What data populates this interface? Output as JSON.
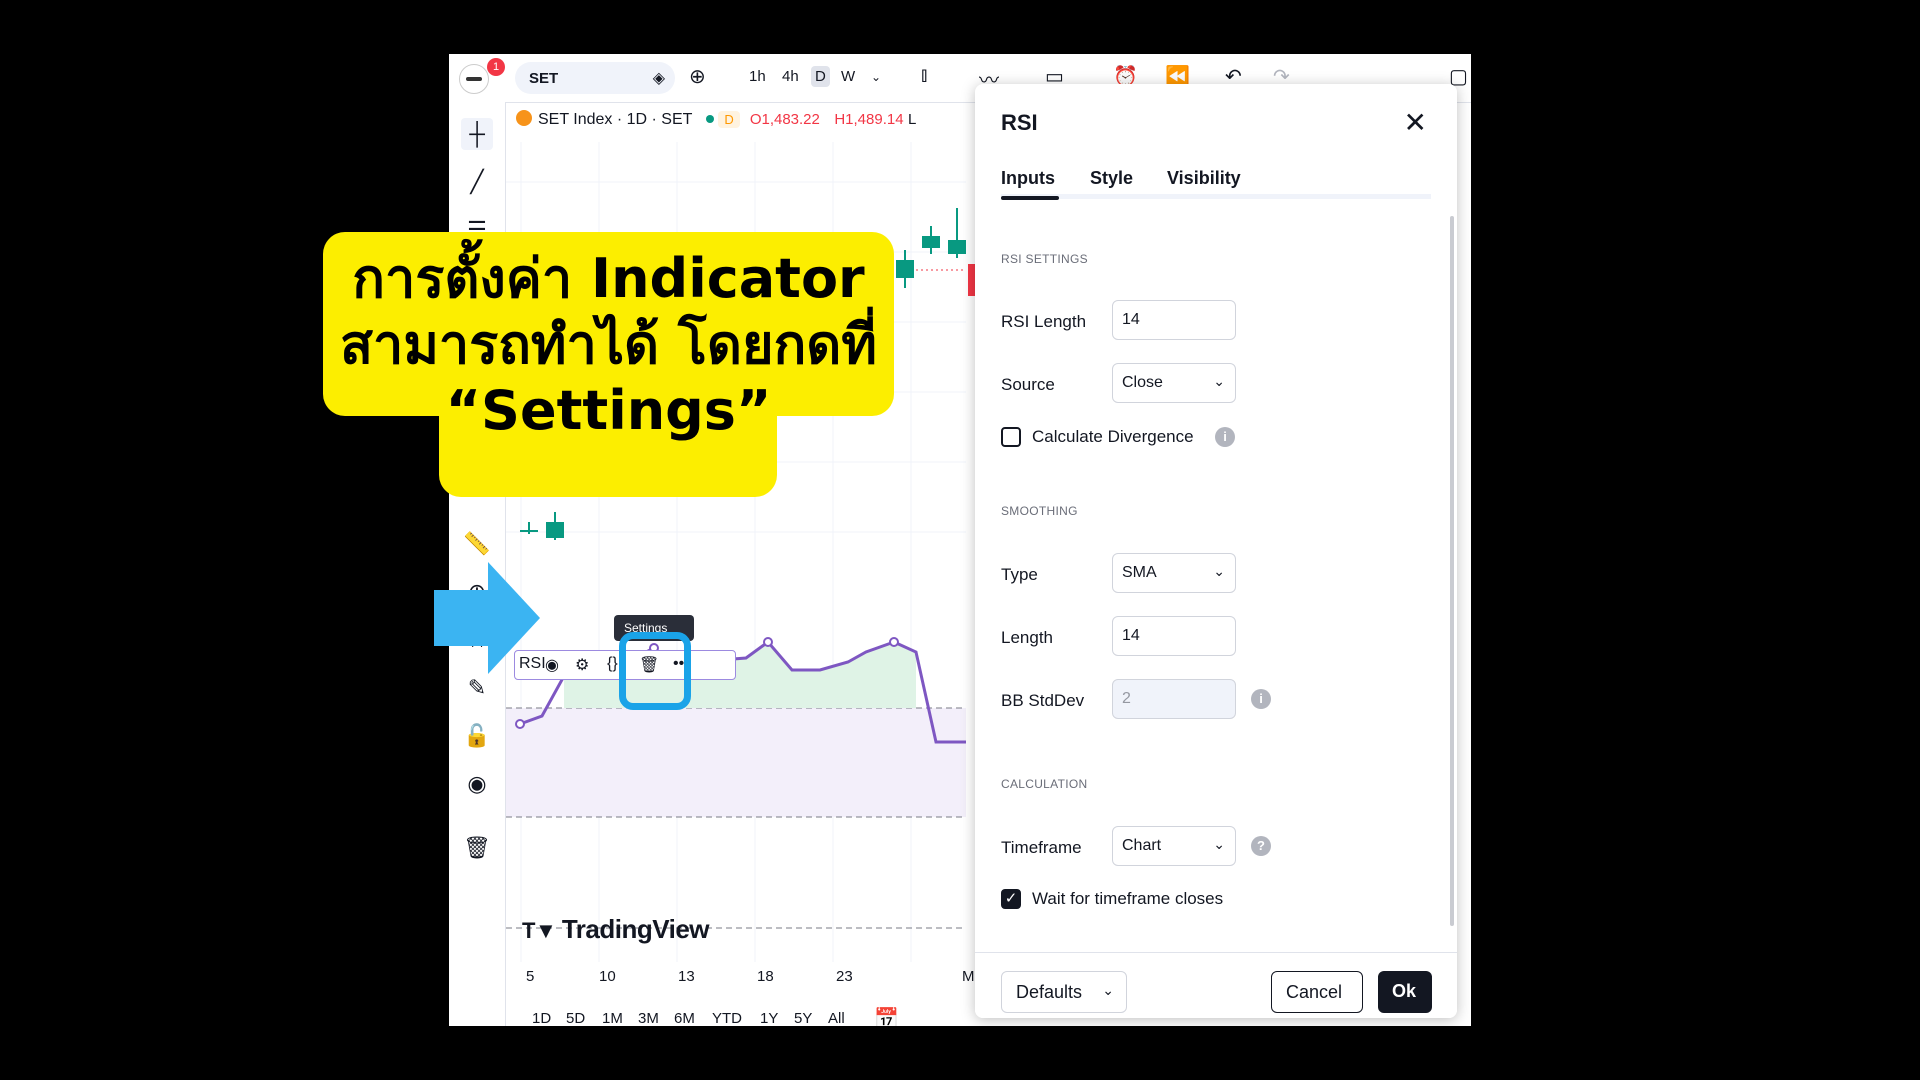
{
  "annotation": {
    "line1": "การตั้งค่า Indicator",
    "line2": "สามารถทำได้ โดยกดที่",
    "line3": "“Settings”",
    "color": "#fcee00",
    "arrow_color": "#3bb4f2"
  },
  "toolbar": {
    "badge_count": "1",
    "symbol": "SET",
    "intervals": [
      "1h",
      "4h",
      "D",
      "W"
    ],
    "active_interval": "D"
  },
  "legend": {
    "title": "SET Index · 1D · SET",
    "tag": "D",
    "open": "O1,483.22",
    "high": "H1,489.14",
    "extra": "L"
  },
  "pane": {
    "name": "RSI",
    "tooltip": "Settings"
  },
  "chart": {
    "logo": "TradingView",
    "x_labels": [
      "5",
      "10",
      "13",
      "18",
      "23",
      "M"
    ],
    "ranges": [
      "1D",
      "5D",
      "1M",
      "3M",
      "6M",
      "YTD",
      "1Y",
      "5Y",
      "All"
    ],
    "rsi_color": "#7e57c2",
    "up_color": "#089981",
    "down_color": "#f23645"
  },
  "dialog": {
    "title": "RSI",
    "tabs": [
      "Inputs",
      "Style",
      "Visibility"
    ],
    "active_tab": "Inputs",
    "sections": {
      "rsi_settings": "RSI SETTINGS",
      "smoothing": "SMOOTHING",
      "calculation": "CALCULATION"
    },
    "fields": {
      "rsi_length_label": "RSI Length",
      "rsi_length_value": "14",
      "source_label": "Source",
      "source_value": "Close",
      "divergence_label": "Calculate Divergence",
      "divergence_checked": false,
      "type_label": "Type",
      "type_value": "SMA",
      "length_label": "Length",
      "length_value": "14",
      "bb_label": "BB StdDev",
      "bb_value": "2",
      "timeframe_label": "Timeframe",
      "timeframe_value": "Chart",
      "wait_label": "Wait for timeframe closes",
      "wait_checked": true
    },
    "buttons": {
      "defaults": "Defaults",
      "cancel": "Cancel",
      "ok": "Ok"
    }
  }
}
